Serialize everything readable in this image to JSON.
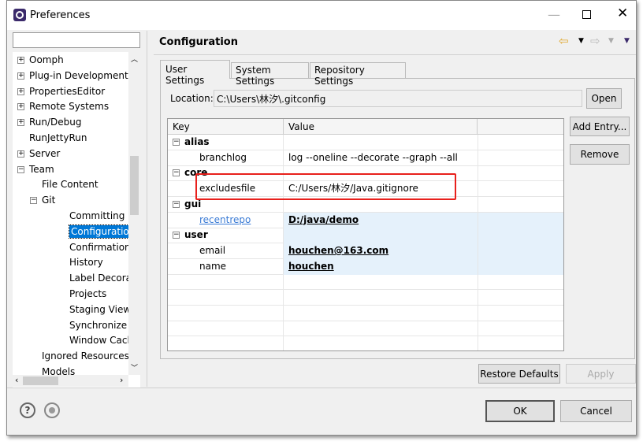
{
  "window": {
    "title": "Preferences"
  },
  "filter": {
    "value": ""
  },
  "tree": {
    "items": [
      {
        "label": "Oomph",
        "level": 0,
        "expander": "+"
      },
      {
        "label": "Plug-in Development",
        "level": 0,
        "expander": "+"
      },
      {
        "label": "PropertiesEditor",
        "level": 0,
        "expander": "+"
      },
      {
        "label": "Remote Systems",
        "level": 0,
        "expander": "+"
      },
      {
        "label": "Run/Debug",
        "level": 0,
        "expander": "+"
      },
      {
        "label": "RunJettyRun",
        "level": 0,
        "expander": ""
      },
      {
        "label": "Server",
        "level": 0,
        "expander": "+"
      },
      {
        "label": "Team",
        "level": 0,
        "expander": "−"
      },
      {
        "label": "File Content",
        "level": 1,
        "expander": ""
      },
      {
        "label": "Git",
        "level": 1,
        "expander": "−"
      },
      {
        "label": "Committing",
        "level": 2,
        "expander": ""
      },
      {
        "label": "Configuration",
        "level": 2,
        "expander": "",
        "selected": true
      },
      {
        "label": "Confirmations a",
        "level": 2,
        "expander": ""
      },
      {
        "label": "History",
        "level": 2,
        "expander": ""
      },
      {
        "label": "Label Decoratio",
        "level": 2,
        "expander": ""
      },
      {
        "label": "Projects",
        "level": 2,
        "expander": ""
      },
      {
        "label": "Staging View",
        "level": 2,
        "expander": ""
      },
      {
        "label": "Synchronize",
        "level": 2,
        "expander": ""
      },
      {
        "label": "Window Cache",
        "level": 2,
        "expander": ""
      },
      {
        "label": "Ignored Resources",
        "level": 1,
        "expander": ""
      },
      {
        "label": "Models",
        "level": 1,
        "expander": ""
      }
    ]
  },
  "page": {
    "title": "Configuration"
  },
  "tabs": [
    {
      "label": "User Settings",
      "active": true
    },
    {
      "label": "System Settings"
    },
    {
      "label": "Repository Settings"
    }
  ],
  "location": {
    "label": "Location:",
    "value": "C:\\Users\\林汐\\.gitconfig",
    "open": "Open"
  },
  "table": {
    "headers": [
      "Key",
      "Value"
    ],
    "rows": [
      {
        "type": "section",
        "key": "alias",
        "value": ""
      },
      {
        "type": "entry",
        "key": "branchlog",
        "value": "log --oneline --decorate --graph --all"
      },
      {
        "type": "section",
        "key": "core",
        "value": ""
      },
      {
        "type": "entry",
        "key": "excludesfile",
        "value": "C:/Users/林汐/Java.gitignore"
      },
      {
        "type": "section",
        "key": "gui",
        "value": ""
      },
      {
        "type": "entry",
        "key": "recentrepo",
        "value": "D:/java/demo",
        "highlight": true,
        "link": true
      },
      {
        "type": "section",
        "key": "user",
        "value": "",
        "highlight": true
      },
      {
        "type": "entry",
        "key": "email",
        "value": "houchen@163.com",
        "highlight": true
      },
      {
        "type": "entry",
        "key": "name",
        "value": "houchen",
        "highlight": true
      }
    ]
  },
  "buttons": {
    "add_entry": "Add Entry...",
    "remove": "Remove",
    "restore_defaults": "Restore Defaults",
    "apply": "Apply",
    "ok": "OK",
    "cancel": "Cancel"
  },
  "colors": {
    "selection": "#0078d7",
    "highlight_row": "#e5f1fb",
    "annotation": "#e8201c"
  }
}
